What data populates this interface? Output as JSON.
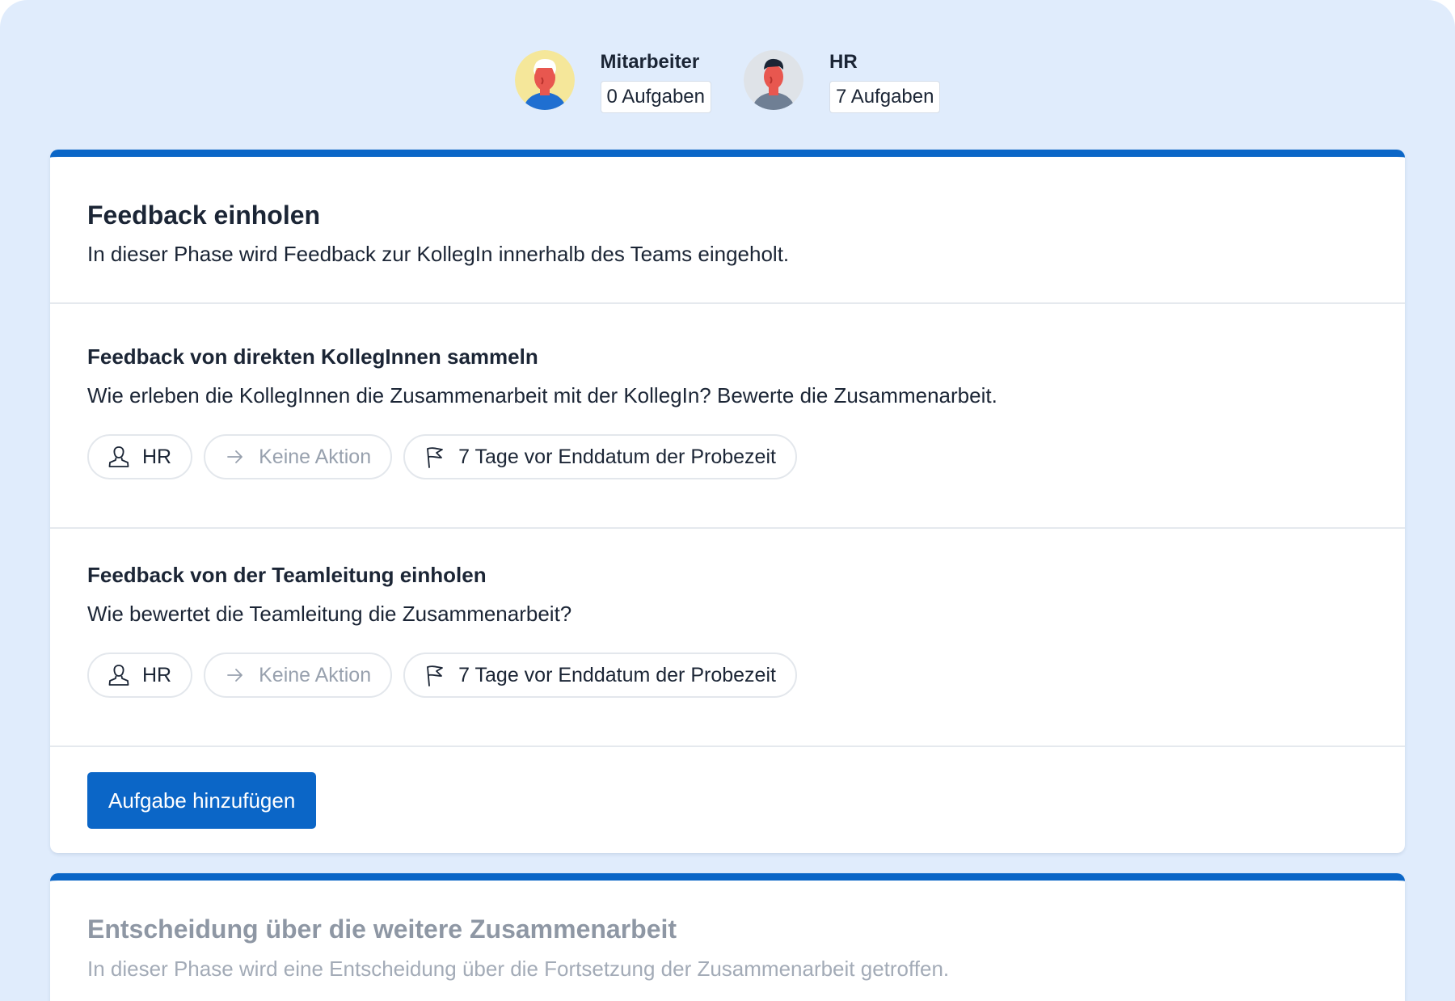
{
  "roles": [
    {
      "name": "Mitarbeiter",
      "count": "0 Aufgaben",
      "avatar_icon": "employee-avatar-icon",
      "avatar_bg": "#f5e79a"
    },
    {
      "name": "HR",
      "count": "7 Aufgaben",
      "avatar_icon": "hr-avatar-icon",
      "avatar_bg": "#dfe3e8"
    }
  ],
  "phases": [
    {
      "title": "Feedback einholen",
      "description": "In dieser Phase wird Feedback zur KollegIn innerhalb des Teams eingeholt.",
      "tasks": [
        {
          "title": "Feedback von direkten KollegInnen sammeln",
          "description": "Wie erleben die KollegInnen die Zusammenarbeit mit der KollegIn? Bewerte die Zusammenarbeit.",
          "assignee": "HR",
          "action": "Keine Aktion",
          "deadline": "7 Tage vor Enddatum der Probezeit"
        },
        {
          "title": "Feedback von der Teamleitung einholen",
          "description": "Wie bewertet die Teamleitung die Zusammenarbeit?",
          "assignee": "HR",
          "action": "Keine Aktion",
          "deadline": "7 Tage vor Enddatum der Probezeit"
        }
      ],
      "add_button": "Aufgabe hinzufügen"
    },
    {
      "title": "Entscheidung über die weitere Zusammenarbeit",
      "description": "In dieser Phase wird eine Entscheidung über die Fortsetzung der Zusammenarbeit getroffen."
    }
  ],
  "colors": {
    "background": "#e0ecfc",
    "accent": "#0b66c7",
    "text": "#1b2535",
    "muted_text": "#98a1ae"
  },
  "icons": {
    "assignee": "user-icon",
    "action": "arrow-right-icon",
    "deadline": "flag-icon"
  }
}
